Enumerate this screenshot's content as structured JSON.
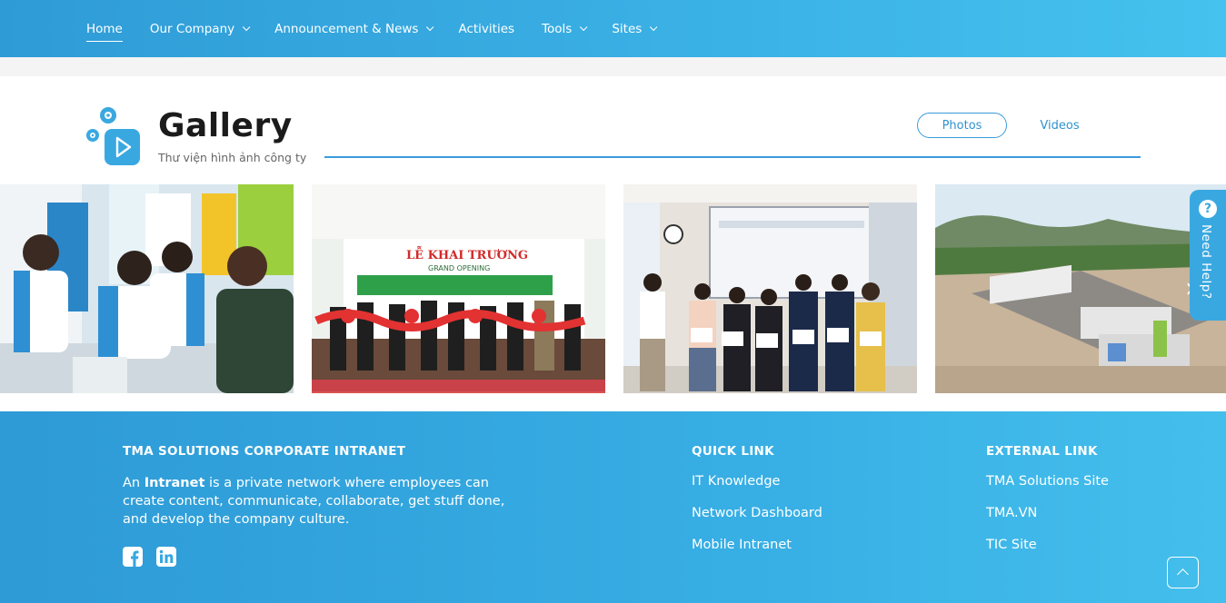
{
  "nav": {
    "items": [
      {
        "label": "Home",
        "active": true,
        "dropdown": false
      },
      {
        "label": "Our Company",
        "active": false,
        "dropdown": true
      },
      {
        "label": "Announcement & News",
        "active": false,
        "dropdown": true
      },
      {
        "label": "Activities",
        "active": false,
        "dropdown": false
      },
      {
        "label": "Tools",
        "active": false,
        "dropdown": true
      },
      {
        "label": "Sites",
        "active": false,
        "dropdown": true
      }
    ]
  },
  "gallery": {
    "title": "Gallery",
    "subtitle": "Thư viện hình ảnh công ty",
    "tabs": {
      "photos": "Photos",
      "videos": "Videos"
    },
    "photos": [
      {
        "icon": "employees-with-phones-photo"
      },
      {
        "icon": "grand-opening-ceremony-photo",
        "banner_title": "LỄ KHAI TRƯƠNG",
        "banner_sub": "GRAND OPENING"
      },
      {
        "icon": "award-certificates-photo"
      },
      {
        "icon": "campus-aerial-photo"
      }
    ],
    "prev_icon": "chevron-left-icon",
    "next_icon": "chevron-right-icon"
  },
  "help": {
    "label": "Need Help?",
    "icon": "?"
  },
  "footer": {
    "about_heading": "TMA SOLUTIONS CORPORATE INTRANET",
    "about_pre": "An ",
    "about_bold": "Intranet",
    "about_post": " is a private network where employees can create content, communicate, collaborate, get stuff done, and develop the company culture.",
    "quick_heading": "QUICK LINK",
    "quick_links": [
      "IT Knowledge",
      "Network Dashboard",
      "Mobile Intranet"
    ],
    "external_heading": "EXTERNAL LINK",
    "external_links": [
      "TMA Solutions Site",
      "TMA.VN",
      "TIC Site"
    ]
  },
  "colors": {
    "brand_blue": "#3bb2e6",
    "accent": "#2f93cf"
  }
}
